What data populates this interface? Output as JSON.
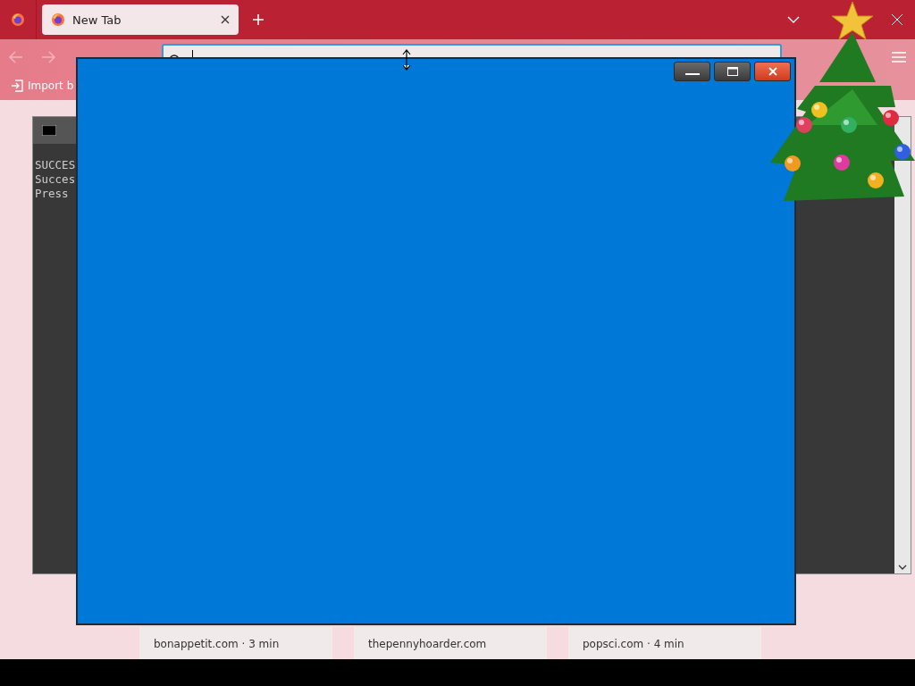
{
  "browser": {
    "tabs": [
      {
        "label": "New Tab",
        "selected": true
      }
    ],
    "bookmarks": [
      {
        "label": "Import b"
      }
    ],
    "cards": [
      {
        "source": "bonappetit.com · 3 min"
      },
      {
        "source": "thepennyhoarder.com"
      },
      {
        "source": "popsci.com · 4 min"
      }
    ]
  },
  "console": {
    "lines": [
      "SUCCES",
      "Succes",
      "Press"
    ]
  }
}
